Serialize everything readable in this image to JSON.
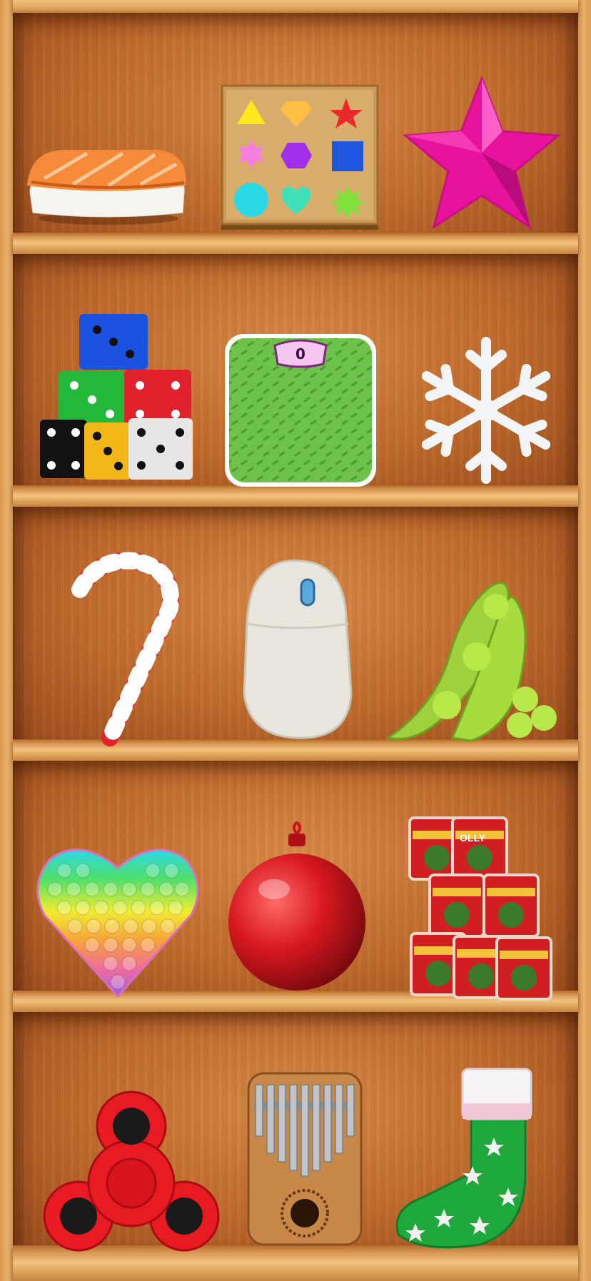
{
  "shelves": [
    {
      "items": [
        {
          "icon": "sushi-icon"
        },
        {
          "icon": "shape-sorter-icon"
        },
        {
          "icon": "pink-star-icon"
        }
      ]
    },
    {
      "items": [
        {
          "icon": "dice-stack-icon"
        },
        {
          "icon": "bathroom-scale-icon",
          "readout": "0"
        },
        {
          "icon": "snowflake-icon"
        }
      ]
    },
    {
      "items": [
        {
          "icon": "candy-cane-icon"
        },
        {
          "icon": "computer-mouse-icon"
        },
        {
          "icon": "edamame-icon"
        }
      ]
    },
    {
      "items": [
        {
          "icon": "pop-it-heart-icon"
        },
        {
          "icon": "christmas-ornament-icon"
        },
        {
          "icon": "tin-can-pyramid-icon",
          "label": "OLLY"
        }
      ]
    },
    {
      "items": [
        {
          "icon": "fidget-spinner-icon"
        },
        {
          "icon": "kalimba-icon"
        },
        {
          "icon": "christmas-stocking-icon"
        }
      ]
    }
  ],
  "colors": {
    "wood_light": "#f2c27d",
    "wood_mid": "#c06a2c",
    "wood_dark": "#9a4c1c"
  }
}
